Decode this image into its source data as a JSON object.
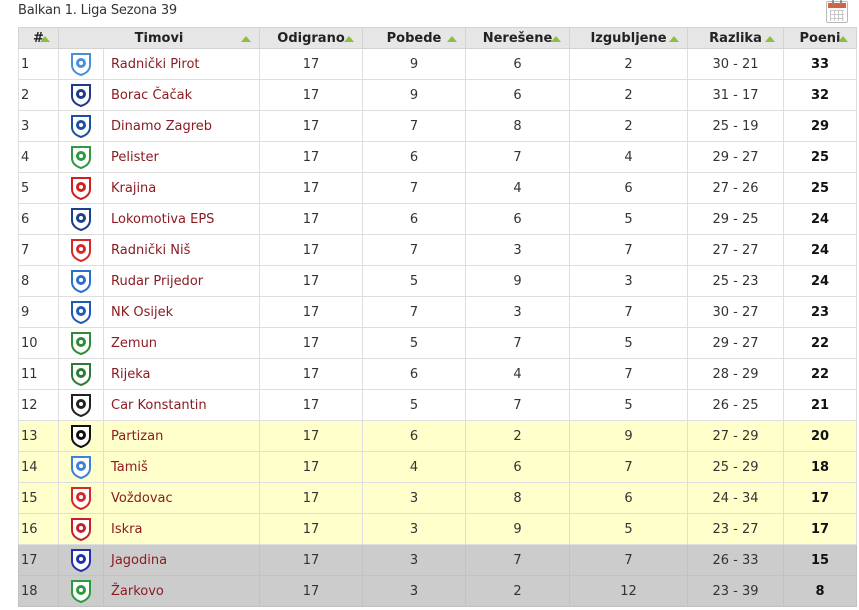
{
  "page": {
    "title": "Balkan 1. Liga Sezona 39",
    "calendar_icon": "calendar-icon"
  },
  "table": {
    "headers": {
      "rank": "#",
      "teams": "Timovi",
      "played": "Odigrano",
      "wins": "Pobede",
      "draws": "Nerešene",
      "losses": "Izgubljene",
      "diff": "Razlika",
      "points": "Poeni"
    },
    "rows": [
      {
        "rank": "1",
        "team": "Radnički Pirot",
        "played": "17",
        "wins": "9",
        "draws": "6",
        "losses": "2",
        "diff": "30 - 21",
        "points": "33",
        "zone": "normal",
        "crest": "radnicki-pirot-crest",
        "crest_color": "#4a90d9"
      },
      {
        "rank": "2",
        "team": "Borac Čačak",
        "played": "17",
        "wins": "9",
        "draws": "6",
        "losses": "2",
        "diff": "31 - 17",
        "points": "32",
        "zone": "normal",
        "crest": "borac-cacak-crest",
        "crest_color": "#1e3a8a"
      },
      {
        "rank": "3",
        "team": "Dinamo Zagreb",
        "played": "17",
        "wins": "7",
        "draws": "8",
        "losses": "2",
        "diff": "25 - 19",
        "points": "29",
        "zone": "normal",
        "crest": "dinamo-zagreb-crest",
        "crest_color": "#1d4fa3"
      },
      {
        "rank": "4",
        "team": "Pelister",
        "played": "17",
        "wins": "6",
        "draws": "7",
        "losses": "4",
        "diff": "29 - 27",
        "points": "25",
        "zone": "normal",
        "crest": "pelister-crest",
        "crest_color": "#2e9a44"
      },
      {
        "rank": "5",
        "team": "Krajina",
        "played": "17",
        "wins": "7",
        "draws": "4",
        "losses": "6",
        "diff": "27 - 26",
        "points": "25",
        "zone": "normal",
        "crest": "krajina-crest",
        "crest_color": "#d11f1f"
      },
      {
        "rank": "6",
        "team": "Lokomotiva EPS",
        "played": "17",
        "wins": "6",
        "draws": "6",
        "losses": "5",
        "diff": "29 - 25",
        "points": "24",
        "zone": "normal",
        "crest": "lokomotiva-eps-crest",
        "crest_color": "#1b3f8b"
      },
      {
        "rank": "7",
        "team": "Radnički Niš",
        "played": "17",
        "wins": "7",
        "draws": "3",
        "losses": "7",
        "diff": "27 - 27",
        "points": "24",
        "zone": "normal",
        "crest": "radnicki-nis-crest",
        "crest_color": "#d42a2a"
      },
      {
        "rank": "8",
        "team": "Rudar Prijedor",
        "played": "17",
        "wins": "5",
        "draws": "9",
        "losses": "3",
        "diff": "25 - 23",
        "points": "24",
        "zone": "normal",
        "crest": "rudar-prijedor-crest",
        "crest_color": "#2a6fd0"
      },
      {
        "rank": "9",
        "team": "NK Osijek",
        "played": "17",
        "wins": "7",
        "draws": "3",
        "losses": "7",
        "diff": "30 - 27",
        "points": "23",
        "zone": "normal",
        "crest": "nk-osijek-crest",
        "crest_color": "#1f5bb5"
      },
      {
        "rank": "10",
        "team": "Zemun",
        "played": "17",
        "wins": "5",
        "draws": "7",
        "losses": "5",
        "diff": "29 - 27",
        "points": "22",
        "zone": "normal",
        "crest": "zemun-crest",
        "crest_color": "#2f8a3a"
      },
      {
        "rank": "11",
        "team": "Rijeka",
        "played": "17",
        "wins": "6",
        "draws": "4",
        "losses": "7",
        "diff": "28 - 29",
        "points": "22",
        "zone": "normal",
        "crest": "rijeka-crest",
        "crest_color": "#2d7a36"
      },
      {
        "rank": "12",
        "team": "Car Konstantin",
        "played": "17",
        "wins": "5",
        "draws": "7",
        "losses": "5",
        "diff": "26 - 25",
        "points": "21",
        "zone": "normal",
        "crest": "car-konstantin-crest",
        "crest_color": "#222222"
      },
      {
        "rank": "13",
        "team": "Partizan",
        "played": "17",
        "wins": "6",
        "draws": "2",
        "losses": "9",
        "diff": "27 - 29",
        "points": "20",
        "zone": "yellow",
        "crest": "partizan-crest",
        "crest_color": "#111111"
      },
      {
        "rank": "14",
        "team": "Tamiš",
        "played": "17",
        "wins": "4",
        "draws": "6",
        "losses": "7",
        "diff": "25 - 29",
        "points": "18",
        "zone": "yellow",
        "crest": "tamis-crest",
        "crest_color": "#3a82d6"
      },
      {
        "rank": "15",
        "team": "Voždovac",
        "played": "17",
        "wins": "3",
        "draws": "8",
        "losses": "6",
        "diff": "24 - 34",
        "points": "17",
        "zone": "yellow",
        "crest": "vozdovac-crest",
        "crest_color": "#d62828"
      },
      {
        "rank": "16",
        "team": "Iskra",
        "played": "17",
        "wins": "3",
        "draws": "9",
        "losses": "5",
        "diff": "23 - 27",
        "points": "17",
        "zone": "yellow",
        "crest": "iskra-crest",
        "crest_color": "#c8202a"
      },
      {
        "rank": "17",
        "team": "Jagodina",
        "played": "17",
        "wins": "3",
        "draws": "7",
        "losses": "7",
        "diff": "26 - 33",
        "points": "15",
        "zone": "gray",
        "crest": "jagodina-crest",
        "crest_color": "#2233aa"
      },
      {
        "rank": "18",
        "team": "Žarkovo",
        "played": "17",
        "wins": "3",
        "draws": "2",
        "losses": "12",
        "diff": "23 - 39",
        "points": "8",
        "zone": "gray",
        "crest": "zarkovo-crest",
        "crest_color": "#2e9a3e"
      }
    ]
  },
  "colors": {
    "header_bg": "#e6e6e6",
    "sort_arrow": "#8bbf3f",
    "team_link": "#8a1c22",
    "zone_yellow": "#ffffcc",
    "zone_gray": "#cccccc"
  }
}
